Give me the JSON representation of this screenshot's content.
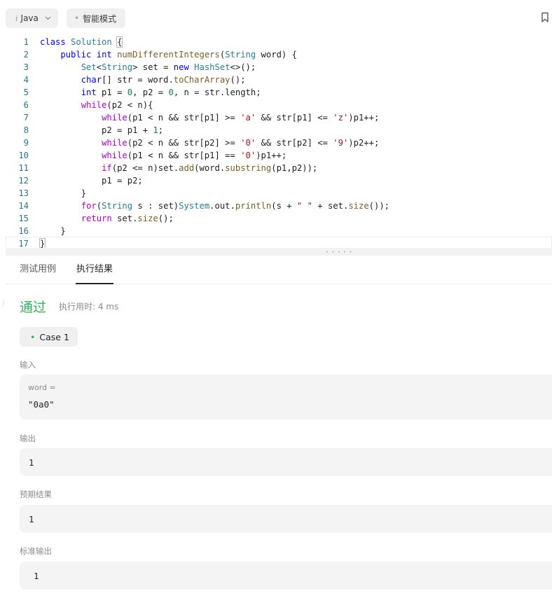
{
  "toolbar": {
    "language": "Java",
    "mode": "智能模式"
  },
  "editor": {
    "language": "java",
    "lines": [
      {
        "n": "1",
        "tokens": [
          {
            "t": "kw",
            "v": "class"
          },
          {
            "t": "",
            "v": " "
          },
          {
            "t": "ty",
            "v": "Solution"
          },
          {
            "t": "",
            "v": " "
          },
          {
            "t": "brace",
            "v": "{"
          }
        ]
      },
      {
        "n": "2",
        "tokens": [
          {
            "t": "",
            "v": "    "
          },
          {
            "t": "kw",
            "v": "public"
          },
          {
            "t": "",
            "v": " "
          },
          {
            "t": "kw",
            "v": "int"
          },
          {
            "t": "",
            "v": " "
          },
          {
            "t": "fn",
            "v": "numDifferentIntegers"
          },
          {
            "t": "",
            "v": "("
          },
          {
            "t": "ty",
            "v": "String"
          },
          {
            "t": "",
            "v": " word) {"
          }
        ]
      },
      {
        "n": "3",
        "tokens": [
          {
            "t": "",
            "v": "        "
          },
          {
            "t": "ty",
            "v": "Set"
          },
          {
            "t": "",
            "v": "<"
          },
          {
            "t": "ty",
            "v": "String"
          },
          {
            "t": "",
            "v": "> set = "
          },
          {
            "t": "kw",
            "v": "new"
          },
          {
            "t": "",
            "v": " "
          },
          {
            "t": "ty",
            "v": "HashSet"
          },
          {
            "t": "",
            "v": "<>();"
          }
        ]
      },
      {
        "n": "4",
        "tokens": [
          {
            "t": "",
            "v": "        "
          },
          {
            "t": "kw",
            "v": "char"
          },
          {
            "t": "",
            "v": "[] str = word."
          },
          {
            "t": "fn",
            "v": "toCharArray"
          },
          {
            "t": "",
            "v": "();"
          }
        ]
      },
      {
        "n": "5",
        "tokens": [
          {
            "t": "",
            "v": "        "
          },
          {
            "t": "kw",
            "v": "int"
          },
          {
            "t": "",
            "v": " p1 = "
          },
          {
            "t": "num",
            "v": "0"
          },
          {
            "t": "",
            "v": ", p2 = "
          },
          {
            "t": "num",
            "v": "0"
          },
          {
            "t": "",
            "v": ", n = str.length;"
          }
        ]
      },
      {
        "n": "6",
        "tokens": [
          {
            "t": "",
            "v": "        "
          },
          {
            "t": "cf",
            "v": "while"
          },
          {
            "t": "",
            "v": "(p2 < n){"
          }
        ]
      },
      {
        "n": "7",
        "tokens": [
          {
            "t": "",
            "v": "            "
          },
          {
            "t": "cf",
            "v": "while"
          },
          {
            "t": "",
            "v": "(p1 < n && str[p1] >= "
          },
          {
            "t": "str",
            "v": "'a'"
          },
          {
            "t": "",
            "v": " && str[p1] <= "
          },
          {
            "t": "str",
            "v": "'z'"
          },
          {
            "t": "",
            "v": ")p1++;"
          }
        ]
      },
      {
        "n": "8",
        "tokens": [
          {
            "t": "",
            "v": "            p2 = p1 + "
          },
          {
            "t": "num",
            "v": "1"
          },
          {
            "t": "",
            "v": ";"
          }
        ]
      },
      {
        "n": "9",
        "tokens": [
          {
            "t": "",
            "v": "            "
          },
          {
            "t": "cf",
            "v": "while"
          },
          {
            "t": "",
            "v": "(p2 < n && str[p2] >= "
          },
          {
            "t": "str",
            "v": "'0'"
          },
          {
            "t": "",
            "v": " && str[p2] <= "
          },
          {
            "t": "str",
            "v": "'9'"
          },
          {
            "t": "",
            "v": ")p2++;"
          }
        ]
      },
      {
        "n": "10",
        "tokens": [
          {
            "t": "",
            "v": "            "
          },
          {
            "t": "cf",
            "v": "while"
          },
          {
            "t": "",
            "v": "(p1 < n && str[p1] == "
          },
          {
            "t": "str",
            "v": "'0'"
          },
          {
            "t": "",
            "v": ")p1++;"
          }
        ]
      },
      {
        "n": "11",
        "tokens": [
          {
            "t": "",
            "v": "            "
          },
          {
            "t": "cf",
            "v": "if"
          },
          {
            "t": "",
            "v": "(p2 <= n)set."
          },
          {
            "t": "fn",
            "v": "add"
          },
          {
            "t": "",
            "v": "(word."
          },
          {
            "t": "fn",
            "v": "substring"
          },
          {
            "t": "",
            "v": "(p1,p2));"
          }
        ]
      },
      {
        "n": "12",
        "tokens": [
          {
            "t": "",
            "v": "            p1 = p2;"
          }
        ]
      },
      {
        "n": "13",
        "tokens": [
          {
            "t": "",
            "v": "        }"
          }
        ]
      },
      {
        "n": "14",
        "tokens": [
          {
            "t": "",
            "v": "        "
          },
          {
            "t": "cf",
            "v": "for"
          },
          {
            "t": "",
            "v": "("
          },
          {
            "t": "ty",
            "v": "String"
          },
          {
            "t": "",
            "v": " s : set)"
          },
          {
            "t": "ty",
            "v": "System"
          },
          {
            "t": "",
            "v": ".out."
          },
          {
            "t": "fn",
            "v": "println"
          },
          {
            "t": "",
            "v": "(s + "
          },
          {
            "t": "str",
            "v": "\" \""
          },
          {
            "t": "",
            "v": " + set."
          },
          {
            "t": "fn",
            "v": "size"
          },
          {
            "t": "",
            "v": "());"
          }
        ]
      },
      {
        "n": "15",
        "tokens": [
          {
            "t": "",
            "v": "        "
          },
          {
            "t": "cf",
            "v": "return"
          },
          {
            "t": "",
            "v": " set."
          },
          {
            "t": "fn",
            "v": "size"
          },
          {
            "t": "",
            "v": "();"
          }
        ]
      },
      {
        "n": "16",
        "tokens": [
          {
            "t": "",
            "v": "    }"
          }
        ]
      },
      {
        "n": "17",
        "tokens": [
          {
            "t": "brace",
            "v": "}"
          }
        ]
      }
    ]
  },
  "tabs": {
    "test_case": "测试用例",
    "result": "执行结果"
  },
  "result": {
    "status": "通过",
    "runtime": "执行用时: 4 ms",
    "case_label": "Case 1",
    "input_label": "输入",
    "input_var": "word =",
    "input_value": "\"0a0\"",
    "output_label": "输出",
    "output_value": "1",
    "expected_label": "预期结果",
    "expected_value": "1",
    "stdout_label": "标准输出",
    "stdout_value": "1"
  },
  "colors": {
    "accent_success": "#2db55d",
    "keyword": "#0000ff",
    "control": "#af00db",
    "type": "#267f99",
    "function": "#795e26",
    "string": "#a31515",
    "number": "#098658"
  },
  "icons": {
    "language_prefix": "info-italic-icon",
    "language_dropdown": "chevron-down-icon",
    "mode_dot": "dot-icon",
    "bookmark": "bookmark-icon"
  }
}
